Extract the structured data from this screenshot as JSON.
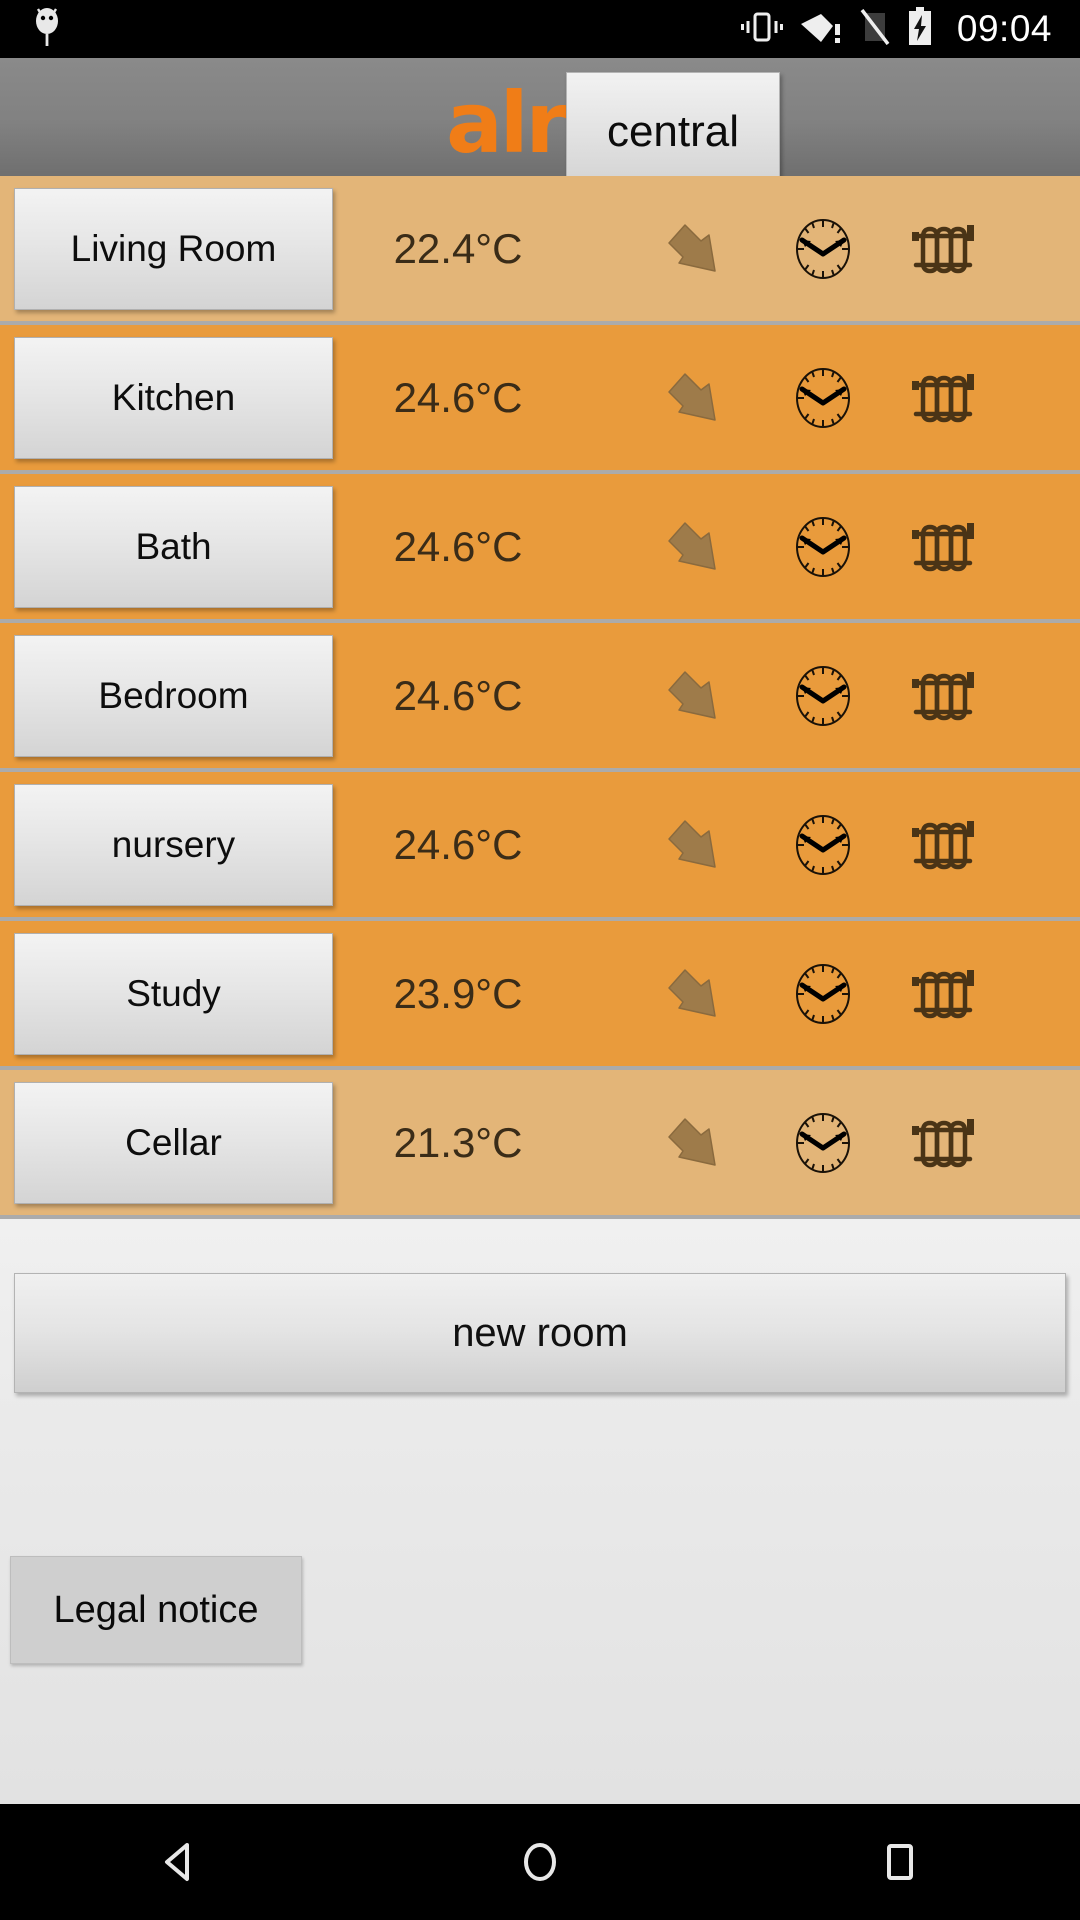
{
  "statusbar": {
    "time": "09:04",
    "icons": [
      "android-bug-icon",
      "vibrate-icon",
      "wifi-alert-icon",
      "no-sim-icon",
      "battery-charging-icon"
    ]
  },
  "header": {
    "logo_text": "alre",
    "logo_color": "#F07D17",
    "central_label": "central"
  },
  "rooms": [
    {
      "name": "Living Room",
      "temperature": "22.4°C",
      "shade": "light"
    },
    {
      "name": "Kitchen",
      "temperature": "24.6°C",
      "shade": "dark"
    },
    {
      "name": "Bath",
      "temperature": "24.6°C",
      "shade": "dark"
    },
    {
      "name": "Bedroom",
      "temperature": "24.6°C",
      "shade": "dark"
    },
    {
      "name": "nursery",
      "temperature": "24.6°C",
      "shade": "dark"
    },
    {
      "name": "Study",
      "temperature": "23.9°C",
      "shade": "dark"
    },
    {
      "name": "Cellar",
      "temperature": "21.3°C",
      "shade": "light"
    }
  ],
  "row_icons": {
    "arrow": "arrow-down-right-icon",
    "clock": "clock-icon",
    "radiator": "radiator-icon"
  },
  "actions": {
    "new_room_label": "new room",
    "legal_notice_label": "Legal notice"
  },
  "navbar": {
    "back": "back-triangle-icon",
    "home": "home-circle-icon",
    "recents": "recents-square-icon"
  },
  "colors": {
    "accent_orange": "#F07D17",
    "row_light": "#e3b578",
    "row_dark": "#e99b3c",
    "row_divider": "#ababab",
    "header_gray": "#818181"
  }
}
